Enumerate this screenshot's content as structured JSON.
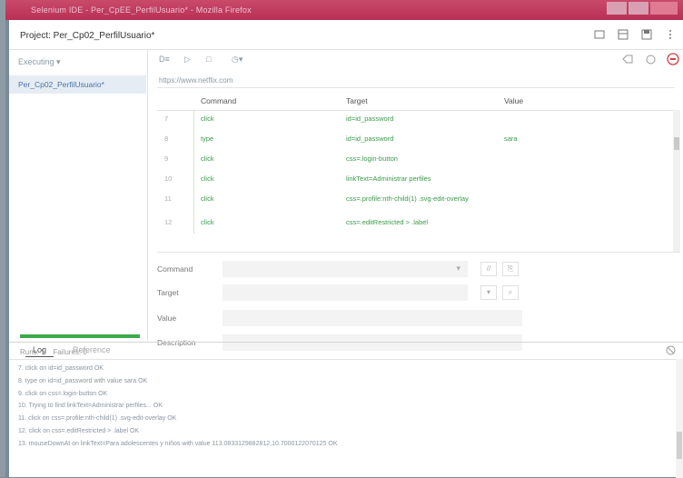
{
  "window": {
    "title": "Selenium IDE - Per_CpEE_PerfilUsuario* - Mozilla Firefox"
  },
  "project": {
    "title": "Project: Per_Cp02_PerfilUsuario*"
  },
  "sidebar": {
    "executing_label": "Executing",
    "test_name": "Per_Cp02_PerfilUsuario*",
    "runs_label": "Runs: 1",
    "failures_label": "Failures: 0"
  },
  "toolbar": {
    "run_all_label": "D≡",
    "run_label": "▷",
    "pause_label": "□",
    "speed_label": "◷▾"
  },
  "url_bar": {
    "value": "https://www.netflix.com"
  },
  "table": {
    "headers": [
      "Command",
      "Target",
      "Value"
    ],
    "rows": [
      {
        "num": "7",
        "command": "click",
        "target": "id=id_password",
        "value": ""
      },
      {
        "num": "8",
        "command": "type",
        "target": "id=id_password",
        "value": "sara"
      },
      {
        "num": "9",
        "command": "click",
        "target": "css=.login-button",
        "value": ""
      },
      {
        "num": "10",
        "command": "click",
        "target": "linkText=Administrar perfiles",
        "value": ""
      },
      {
        "num": "11",
        "command": "click",
        "target": "css=.profile:nth-child(1) .svg-edit-overlay",
        "value": ""
      },
      {
        "num": "12",
        "command": "click",
        "target": "css=.editRestricted > .label",
        "value": ""
      }
    ]
  },
  "form": {
    "command_label": "Command",
    "target_label": "Target",
    "value_label": "Value",
    "description_label": "Description"
  },
  "bottom": {
    "tabs": [
      "Log",
      "Reference"
    ],
    "log_lines": [
      "7. click on id=id_password OK",
      "8. type on id=id_password with value sara OK",
      "9. click on css=.login-button OK",
      "10. Trying to find linkText=Administrar perfiles... OK",
      "11. click on css=.profile:nth-child(1) .svg-edit-overlay OK",
      "12. click on css=.editRestricted > .label OK",
      "13. mouseDownAt on linkText=Para adolescentes y niños with value 113.0833129882812,10.7000122070125 OK"
    ]
  }
}
